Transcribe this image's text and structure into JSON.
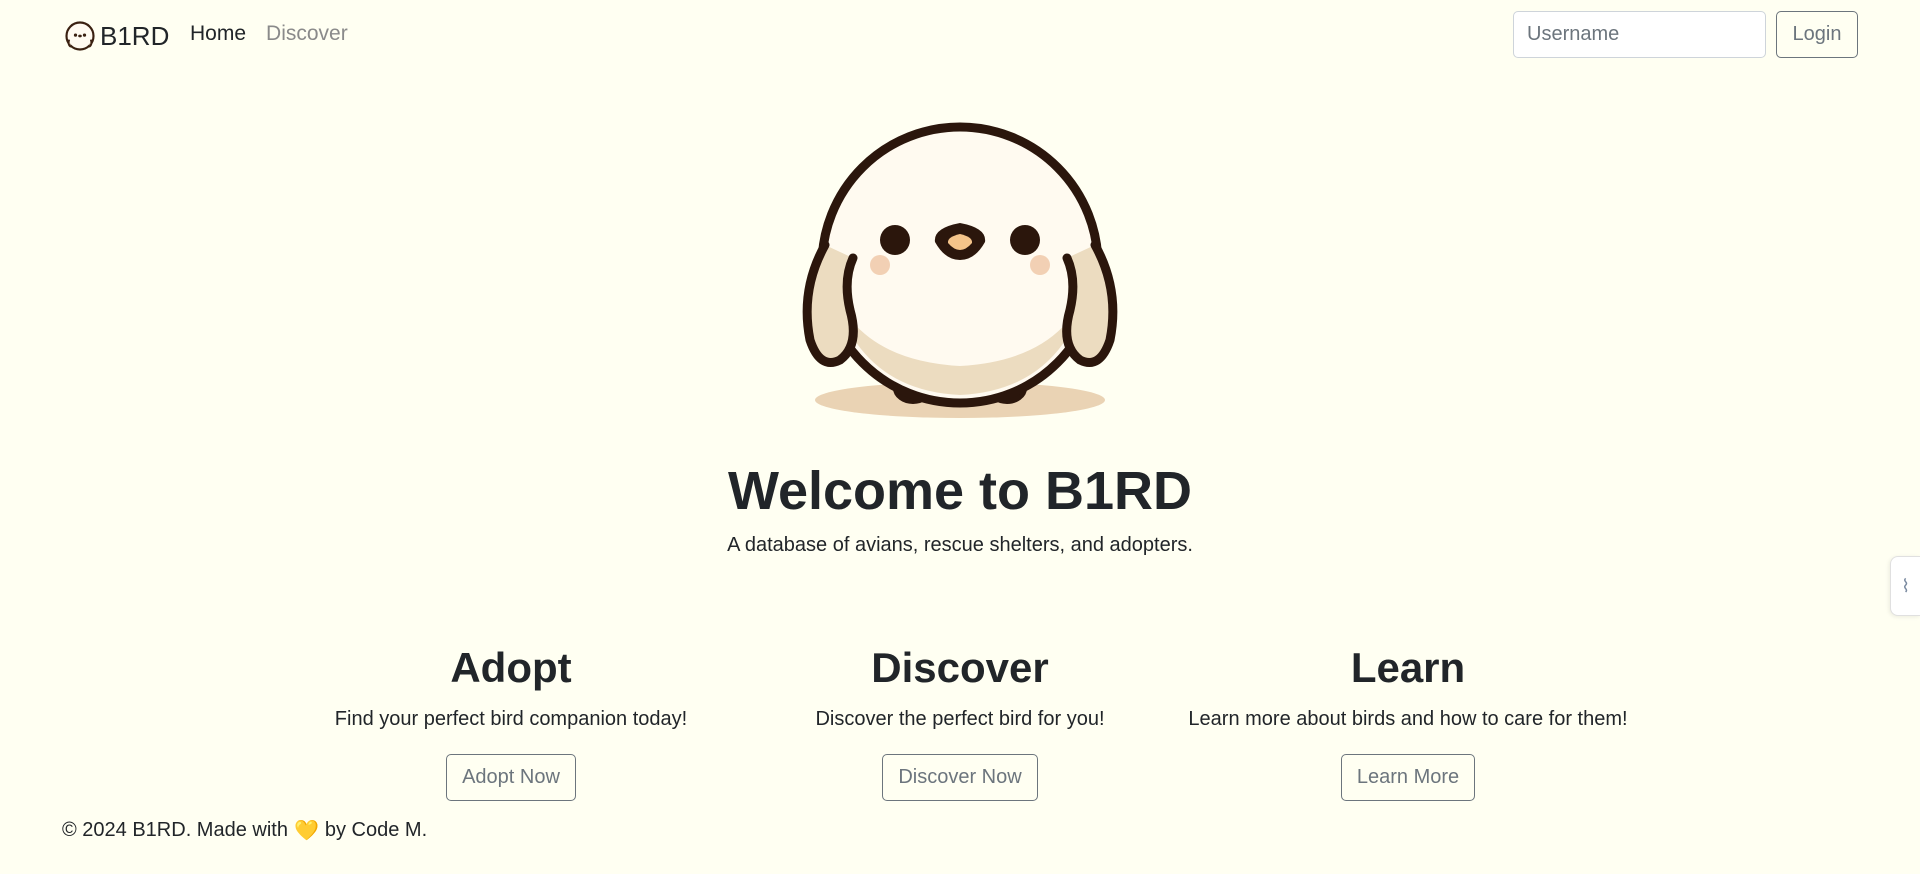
{
  "navbar": {
    "brand": "B1RD",
    "links": [
      {
        "label": "Home",
        "active": true
      },
      {
        "label": "Discover",
        "active": false
      }
    ],
    "search": {
      "placeholder": "Username",
      "value": ""
    },
    "login_label": "Login"
  },
  "hero": {
    "image_icon": "bird-mascot-icon",
    "title": "Welcome to B1RD",
    "subtitle": "A database of avians, rescue shelters, and adopters."
  },
  "features": [
    {
      "title": "Adopt",
      "text": "Find your perfect bird companion today!",
      "button": "Adopt Now"
    },
    {
      "title": "Discover",
      "text": "Discover the perfect bird for you!",
      "button": "Discover Now"
    },
    {
      "title": "Learn",
      "text": "Learn more about birds and how to care for them!",
      "button": "Learn More"
    }
  ],
  "footer": {
    "prefix": "© 2024 B1RD. Made with",
    "heart": "💛",
    "suffix": "by Code M."
  },
  "side_tab": {
    "icon": "extension-tab-icon",
    "glyph": "⌇"
  },
  "colors": {
    "background": "#fffff2",
    "text": "#212529",
    "muted": "#6c757d",
    "bird_outline": "#2b160c",
    "bird_body": "#fffaf0",
    "bird_shade": "#ecdcc0"
  }
}
